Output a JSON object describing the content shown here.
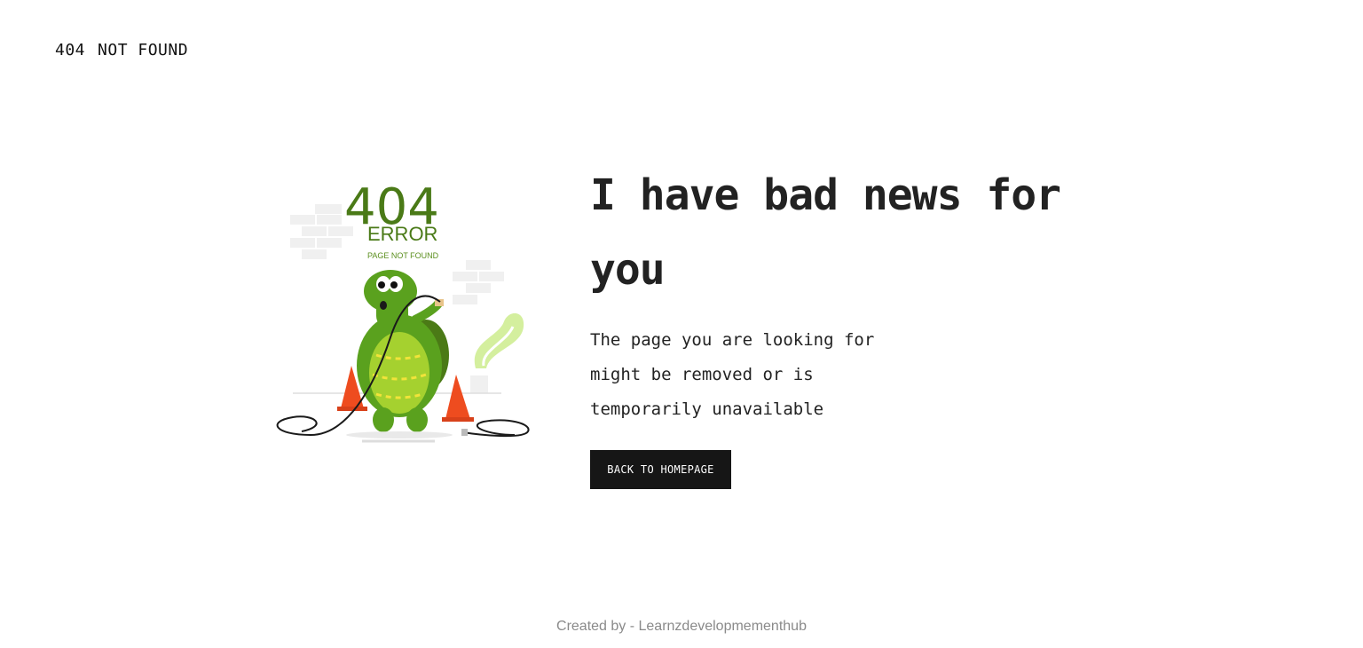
{
  "header": {
    "code": "404",
    "status": "NOT FOUND"
  },
  "illustration": {
    "big_code": "404",
    "error_word": "ERROR",
    "sub_label": "PAGE NOT FOUND",
    "subject": "turtle-icon"
  },
  "main": {
    "headline": "I have bad news for you",
    "message": "The page you are looking for might be removed or is temporarily unavailable",
    "button_label": "BACK TO HOMEPAGE"
  },
  "footer": {
    "credit": "Created by - Learnzdevelopmementhub"
  },
  "colors": {
    "accent_green": "#4a7a17",
    "button_bg": "#161616",
    "cone_orange": "#ee4c1f"
  }
}
